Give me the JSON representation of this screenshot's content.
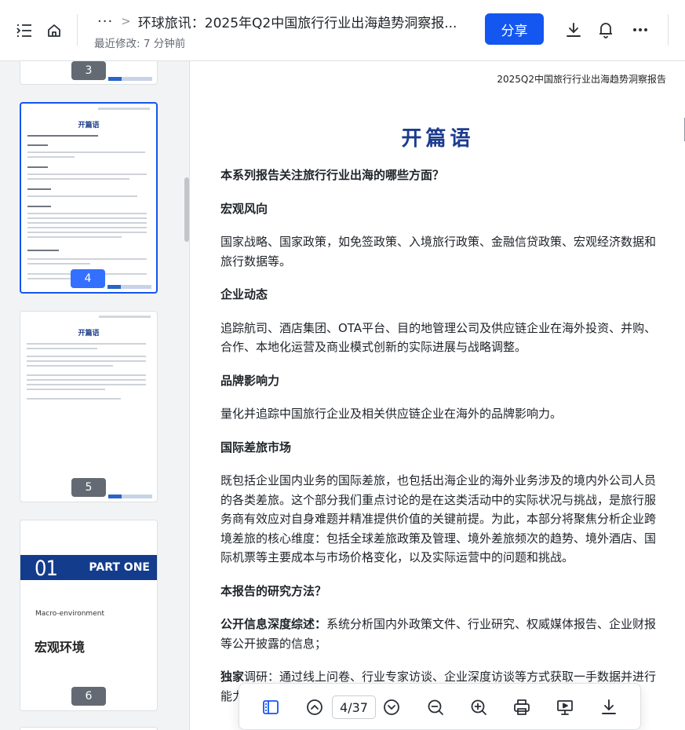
{
  "header": {
    "title": "环球旅讯：2025年Q2中国旅行行业出海趋势洞察报...",
    "last_modified": "最近修改: 7 分钟前",
    "share_label": "分享",
    "breadcrumb_more": "···",
    "breadcrumb_sep": ">"
  },
  "icons": {
    "outline_toggle": "outline-icon",
    "home": "home-icon",
    "download": "download-icon",
    "notifications": "bell-icon",
    "more": "more-icon"
  },
  "sidebar": {
    "thumbnails": [
      {
        "page": "3"
      },
      {
        "page": "4",
        "selected": true,
        "title": "开篇语"
      },
      {
        "page": "5",
        "title": "开篇语"
      },
      {
        "page": "6",
        "part_num": "01",
        "part_label": "PART ONE",
        "en": "Macro-environment",
        "zh": "宏观环境"
      }
    ]
  },
  "document": {
    "page_header": "2025Q2中国旅行行业出海趋势洞察报告",
    "title": "开篇语",
    "blocks": [
      {
        "kind": "h",
        "text": "本系列报告关注旅行行业出海的哪些方面？"
      },
      {
        "kind": "h",
        "text": "宏观风向"
      },
      {
        "kind": "p",
        "text": "国家战略、国家政策，如免签政策、入境旅行政策、金融信贷政策、宏观经济数据和旅行数据等。"
      },
      {
        "kind": "h",
        "text": "企业动态"
      },
      {
        "kind": "p",
        "text": "追踪航司、酒店集团、OTA平台、目的地管理公司及供应链企业在海外投资、并购、合作、本地化运营及商业模式创新的实际进展与战略调整。"
      },
      {
        "kind": "h",
        "text": "品牌影响力"
      },
      {
        "kind": "p",
        "text": "量化并追踪中国旅行企业及相关供应链企业在海外的品牌影响力。"
      },
      {
        "kind": "h",
        "text": "国际差旅市场"
      },
      {
        "kind": "p",
        "text": "既包括企业国内业务的国际差旅，也包括出海企业的海外业务涉及的境内外公司人员的各类差旅。这个部分我们重点讨论的是在这类活动中的实际状况与挑战，是旅行服务商有效应对自身难题并精准提供价值的关键前提。为此，本部分将聚焦分析企业跨境差旅的核心维度：包括全球差旅政策及管理、境外差旅频次的趋势、境外酒店、国际机票等主要成本与市场价格变化，以及实际运营中的问题和挑战。"
      },
      {
        "kind": "h",
        "text": "本报告的研究方法？"
      },
      {
        "kind": "lp",
        "label": "公开信息深度综述：",
        "text": "系统分析国内外政策文件、行业研究、权威媒体报告、企业财报等公开披露的信息；"
      },
      {
        "kind": "lp",
        "label": "独家",
        "text": "调研：通过线上问卷、行业专家访谈、企业深度访谈等方式获取一手数据并进行能力评估。"
      }
    ]
  },
  "toolbar": {
    "page_indicator": "4/37"
  },
  "colors": {
    "accent": "#1456f0",
    "doc_title": "#1d3c8f",
    "sidebar_bg": "#f2f3f5"
  }
}
